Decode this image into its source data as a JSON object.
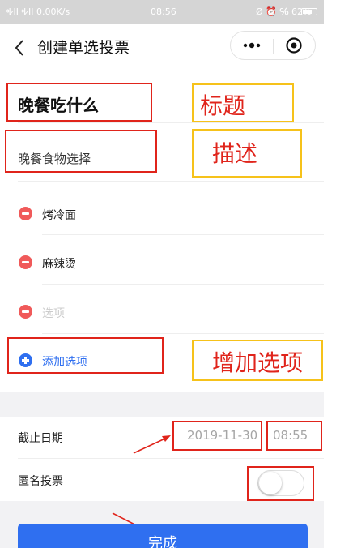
{
  "status_bar": {
    "signal_text": "ᎭII ᎭII 0.00K/s",
    "time": "08:56",
    "indicators": "Ø ⏰ ℅ 62%"
  },
  "nav": {
    "back_icon": "chevron-left-icon",
    "title": "创建单选投票",
    "more_icon": "more-dots-icon",
    "close_icon": "target-circle-icon"
  },
  "form": {
    "title_value": "晚餐吃什么",
    "description_value": "晚餐食物选择",
    "options": [
      {
        "value": "烤冷面"
      },
      {
        "value": "麻辣烫"
      }
    ],
    "new_option_placeholder": "选项",
    "add_option_label": "添加选项"
  },
  "settings": {
    "deadline_label": "截止日期",
    "deadline_date": "2019-11-30",
    "deadline_time": "08:55",
    "anonymous_label": "匿名投票",
    "anonymous_enabled": false
  },
  "submit_label": "完成",
  "annotations": {
    "title_note": "标题",
    "description_note": "描述",
    "add_option_note": "增加选项"
  },
  "colors": {
    "primary": "#2f6ff0",
    "delete": "#f05a5a",
    "annotation_red": "#e0241b",
    "annotation_yellow": "#f6c21a"
  }
}
